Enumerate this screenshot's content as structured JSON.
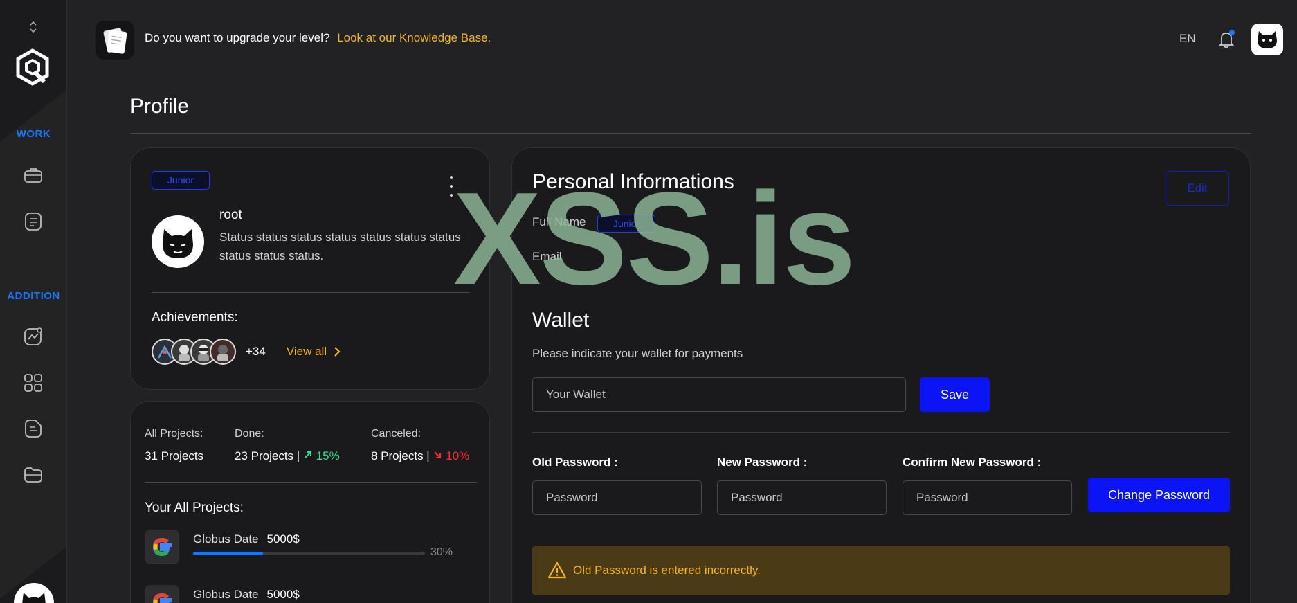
{
  "topbar": {
    "question": "Do you want to upgrade your level?",
    "link": "Look at our Knowledge Base.",
    "language": "EN"
  },
  "sidebar": {
    "sections": [
      {
        "label": "WORK"
      },
      {
        "label": "ADDITION"
      }
    ]
  },
  "page_title": "Profile",
  "profile": {
    "level_badge": "Junior",
    "name": "root",
    "status": "Status status status status status status status status status status.",
    "achievements_label": "Achievements:",
    "achievements_more": "+34",
    "view_all": "View all"
  },
  "projects": {
    "all_label": "All Projects:",
    "all_value": "31 Projects",
    "done_label": "Done:",
    "done_value": "23 Projects |",
    "done_change": "15%",
    "canceled_label": "Canceled:",
    "canceled_value": "8 Projects |",
    "canceled_change": "10%",
    "list_title": "Your All Projects:",
    "items": [
      {
        "name": "Globus Date",
        "price": "5000$",
        "progress_pct": 30,
        "progress_label": "30%"
      },
      {
        "name": "Globus Date",
        "price": "5000$",
        "progress_pct": 0,
        "progress_label": ""
      }
    ]
  },
  "personal_info": {
    "title": "Personal Informations",
    "edit": "Edit",
    "full_name_label": "Full Name",
    "full_name_badge": "Junior",
    "email_label": "Email"
  },
  "wallet": {
    "title": "Wallet",
    "description": "Please indicate your wallet for payments",
    "placeholder": "Your Wallet",
    "save": "Save"
  },
  "password": {
    "old_label": "Old Password :",
    "new_label": "New Password :",
    "confirm_label": "Confirm New Password :",
    "placeholder": "Password",
    "change": "Change Password"
  },
  "alert": {
    "message": "Old Password is entered incorrectly."
  },
  "watermark": "XSS.is",
  "colors": {
    "accent_blue": "#0a14f5",
    "link_yellow": "#f5b524",
    "up_green": "#2de08e",
    "down_red": "#ff2b3a"
  }
}
